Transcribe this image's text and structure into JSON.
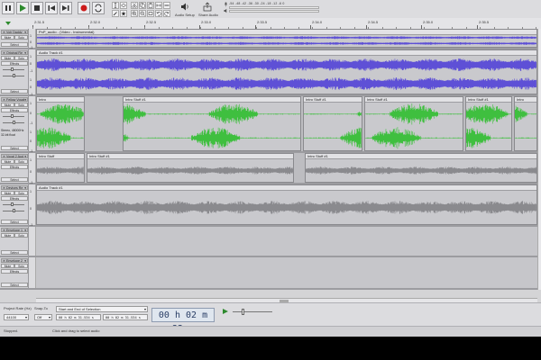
{
  "toolbar": {
    "audio_setup_label": "Audio Setup",
    "share_audio_label": "Share Audio",
    "meter_scale": "-54 -48 -42 -36 -30 -24 -18 -12 -6 0",
    "colors": {
      "play": "#2d8a2d",
      "record": "#cc1b1b"
    }
  },
  "ruler": {
    "ticks": [
      "2:31.5",
      "2:32.0",
      "2:32.5",
      "2:33.0",
      "2:33.5",
      "2:34.0",
      "2:34.5",
      "2:35.0",
      "2:35.5"
    ]
  },
  "tracks": [
    {
      "name": "Voh Daddy",
      "mute": "Mute",
      "solo": "Solo",
      "select": "Select",
      "scale": [
        "1",
        "0",
        "-1"
      ],
      "clips": [
        {
          "label": "PnP_audio - (Video - Instrumental)"
        }
      ],
      "color": "#5e50d6"
    },
    {
      "name": "Original Re",
      "mute": "Mute",
      "solo": "Solo",
      "effects": "Effects",
      "select": "Select",
      "scale": [
        "1",
        "0",
        "-1",
        "1",
        "0",
        "-1"
      ],
      "clips": [
        {
          "label": "Audio Track #1"
        }
      ],
      "color": "#5e50d6"
    },
    {
      "name": "Fellow Vocal",
      "mute": "Mute",
      "solo": "Solo",
      "effects": "Effects",
      "select": "Select",
      "info": "Stereo, 48000Hz",
      "info2": "32-bit float",
      "scale": [
        "1",
        "0",
        "-1",
        "1",
        "0",
        "-1"
      ],
      "clips": [
        {
          "label": "Intro"
        },
        {
          "label": "Intro Stuff #1"
        },
        {
          "label": "Intro Stuff #1"
        },
        {
          "label": "Intro Stuff #1"
        },
        {
          "label": "Intro Stuff #1"
        },
        {
          "label": "Intro"
        }
      ],
      "color": "#3fbf3f"
    },
    {
      "name": "Vocal 2 Aud",
      "mute": "Mute",
      "solo": "Solo",
      "effects": "Effects",
      "select": "Select",
      "scale": [
        "1",
        "0",
        "-1"
      ],
      "clips": [
        {
          "label": "Intro Stuff"
        },
        {
          "label": "Intro Stuff #1"
        },
        {
          "label": "Intro Stuff #1"
        }
      ],
      "color": "#8a8a8e"
    },
    {
      "name": "Devices Re",
      "mute": "Mute",
      "solo": "Solo",
      "effects": "Effects",
      "select": "Select",
      "scale": [
        "1",
        "0",
        "-1"
      ],
      "clips": [
        {
          "label": "Audio Track #1"
        }
      ],
      "color": "#8a8a8e"
    },
    {
      "name": "Envelope 1",
      "mute": "Mute",
      "solo": "Solo",
      "select": "Select",
      "scale": [],
      "clips": [],
      "color": "#8a8a8e"
    },
    {
      "name": "Envelope 2",
      "mute": "Mute",
      "solo": "Solo",
      "effects": "Effects",
      "select": "Select",
      "scale": [],
      "clips": [],
      "color": "#8a8a8e"
    }
  ],
  "bottom": {
    "project_rate_label": "Project Rate (Hz)",
    "project_rate_value": "44100",
    "snap_label": "Snap-To",
    "snap_value": "Off",
    "selection_label": "Start and End of Selection",
    "selection_start": "00 h 02 m 31.534 s",
    "selection_end": "00 h 02 m 31.534 s",
    "time_display": "00 h 02 m 32 s"
  },
  "status": {
    "left": "Stopped.",
    "center": "Click and drag to select audio"
  }
}
